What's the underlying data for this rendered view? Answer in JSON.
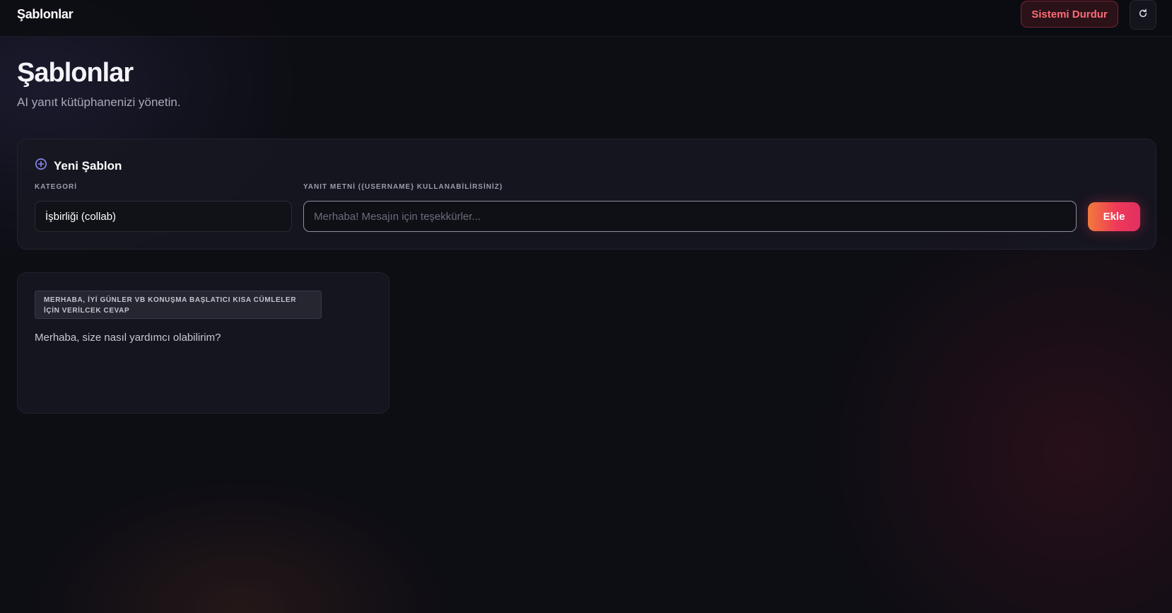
{
  "topbar": {
    "title": "Şablonlar",
    "stop_label": "Sistemi Durdur",
    "refresh_icon": "refresh-icon"
  },
  "header": {
    "title": "Şablonlar",
    "subtitle": "AI yanıt kütüphanenizi yönetin."
  },
  "new_template": {
    "title": "Yeni Şablon",
    "icon": "plus-circle-icon",
    "category_label": "KATEGORİ",
    "category_value": "İşbirliği (collab)",
    "text_label": "YANIT METNİ ({USERNAME} KULLANABİLİRSİNİZ)",
    "text_value": "",
    "text_placeholder": "Merhaba! Mesajın için teşekkürler...",
    "add_label": "Ekle"
  },
  "templates": [
    {
      "category": "MERHABA, İYİ GÜNLER VB KONUŞMA BAŞLATICI KISA CÜMLELER İÇİN VERİLCEK CEVAP",
      "text": "Merhaba, size nasıl yardımcı olabilirim?"
    }
  ],
  "colors": {
    "background": "#0d0d14",
    "danger": "#ff6b78",
    "accent_start": "#f27a3c",
    "accent_end": "#e22f62",
    "icon_accent": "#8b8cf5"
  }
}
